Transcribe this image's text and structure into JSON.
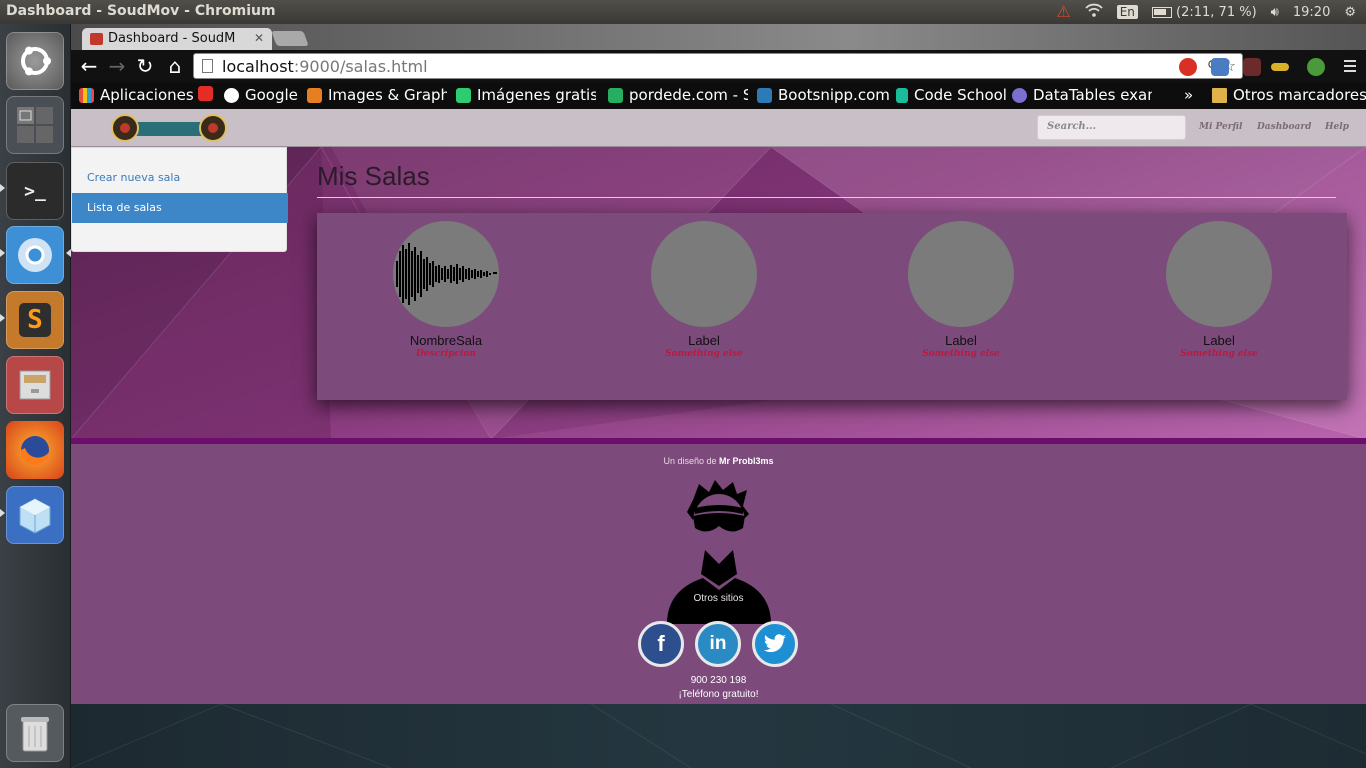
{
  "system": {
    "window_title": "Dashboard - SoudMov - Chromium",
    "keyboard": "En",
    "battery": "(2:11, 71 %)",
    "clock": "19:20"
  },
  "browser": {
    "tab_title": "Dashboard - SoudM",
    "url_host": "localhost",
    "url_rest": ":9000/salas.html",
    "bookmarks": [
      "Aplicaciones",
      "Google",
      "Images & Graphic",
      "Imágenes gratis -",
      "pordede.com - Se",
      "Bootsnipp.com",
      "Code School",
      "DataTables exam"
    ],
    "more_chevron": "»",
    "other_bookmarks": "Otros marcadores"
  },
  "navbar": {
    "search_placeholder": "Search...",
    "links": [
      "Mi Perfil",
      "Dashboard",
      "Help"
    ]
  },
  "sidebar": {
    "items": [
      "Crear nueva sala",
      "Lista de salas"
    ]
  },
  "main": {
    "title": "Mis Salas",
    "cards": [
      {
        "label": "NombreSala",
        "desc": "Descripcion"
      },
      {
        "label": "Label",
        "desc": "Something else"
      },
      {
        "label": "Label",
        "desc": "Something else"
      },
      {
        "label": "Label",
        "desc": "Something else"
      }
    ]
  },
  "footer": {
    "credit_prefix": "Un diseño de ",
    "credit_author": "Mr Probl3ms",
    "otros": "Otros sitios",
    "phone": "900 230 198",
    "phone_note": "¡Teléfono gratuito!"
  },
  "colors": {
    "panel": "#7d4a7c",
    "active": "#3d87c9",
    "desc": "#c1173d"
  }
}
